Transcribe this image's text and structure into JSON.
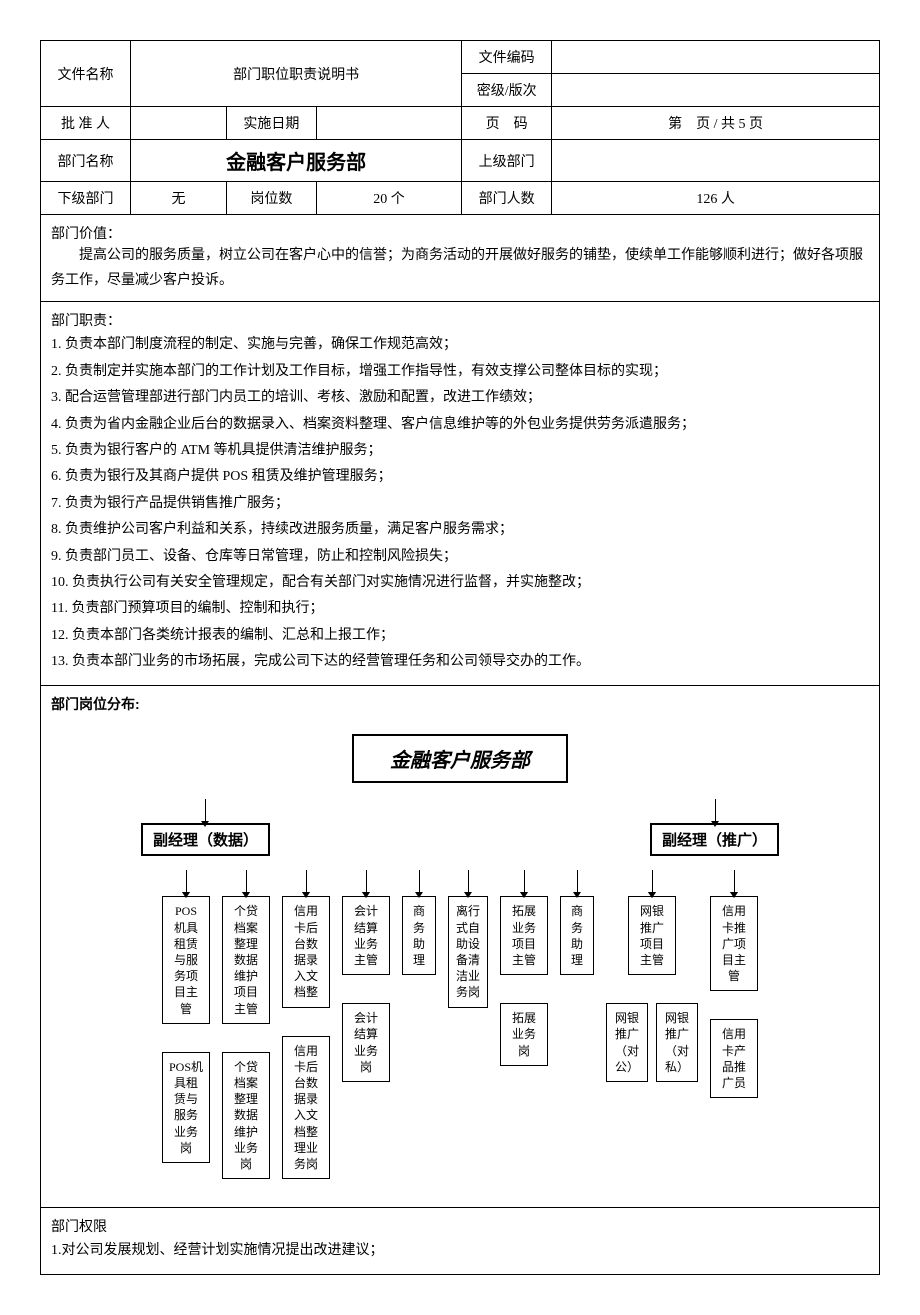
{
  "header": {
    "file_name_label": "文件名称",
    "file_name_value": "部门职位职责说明书",
    "file_code_label": "文件编码",
    "file_code_value": "",
    "secrecy_label": "密级/版次",
    "secrecy_value": "",
    "approver_label": "批 准 人",
    "approver_value": "",
    "impl_date_label": "实施日期",
    "impl_date_value": "",
    "page_code_label": "页　码",
    "page_code_value": "第　页 / 共 5 页",
    "dept_name_label": "部门名称",
    "dept_name_value": "金融客户服务部",
    "superior_label": "上级部门",
    "superior_value": "",
    "subordinate_label": "下级部门",
    "subordinate_value": "无",
    "position_count_label": "岗位数",
    "position_count_value": "20 个",
    "dept_headcount_label": "部门人数",
    "dept_headcount_value": "126 人"
  },
  "value": {
    "heading": "部门价值：",
    "body": "提高公司的服务质量，树立公司在客户心中的信誉；为商务活动的开展做好服务的铺垫，使续单工作能够顺利进行；做好各项服务工作，尽量减少客户投诉。"
  },
  "responsibilities": {
    "heading": "部门职责：",
    "items": [
      "1. 负责本部门制度流程的制定、实施与完善，确保工作规范高效；",
      "2. 负责制定并实施本部门的工作计划及工作目标，增强工作指导性，有效支撑公司整体目标的实现；",
      "3. 配合运营管理部进行部门内员工的培训、考核、激励和配置，改进工作绩效；",
      "4. 负责为省内金融企业后台的数据录入、档案资料整理、客户信息维护等的外包业务提供劳务派遣服务；",
      "5. 负责为银行客户的 ATM 等机具提供清洁维护服务；",
      "6. 负责为银行及其商户提供 POS 租赁及维护管理服务；",
      "7. 负责为银行产品提供销售推广服务；",
      "8. 负责维护公司客户利益和关系，持续改进服务质量，满足客户服务需求；",
      "9. 负责部门员工、设备、仓库等日常管理，防止和控制风险损失；",
      "10. 负责执行公司有关安全管理规定，配合有关部门对实施情况进行监督，并实施整改；",
      "11. 负责部门预算项目的编制、控制和执行；",
      "12. 负责本部门各类统计报表的编制、汇总和上报工作；",
      "13. 负责本部门业务的市场拓展，完成公司下达的经营管理任务和公司领导交办的工作。"
    ]
  },
  "org": {
    "heading": "部门岗位分布:",
    "root": "金融客户服务部",
    "mgr_data": "副经理（数据）",
    "mgr_promo": "副经理（推广）",
    "cols": {
      "c1": "POS 机具租赁与服务项目主管",
      "c1s": "POS机具租赁与服务业务岗",
      "c2": "个贷档案整理数据维护项目主管",
      "c2s": "个贷档案整理数据维护业务岗",
      "c3": "信用卡后台数据录入文档整",
      "c3s": "信用卡后台数据录入文档整理业务岗",
      "c4": "会计结算业务主管",
      "c4s": "会计结算业务岗",
      "c5": "商务助理",
      "c6": "离行式自助设备清洁业务岗",
      "c7": "拓展业务项目主管",
      "c7s": "拓展业务岗",
      "c8": "商务助理",
      "c9": "网银推广项目主管",
      "c9s1": "网银推广（对公）",
      "c9s2": "网银推广（对私）",
      "c10": "信用卡推广项目主管",
      "c10s": "信用卡产品推广员"
    }
  },
  "authority": {
    "heading": "部门权限",
    "items": [
      "1.对公司发展规划、经营计划实施情况提出改进建议；"
    ]
  }
}
